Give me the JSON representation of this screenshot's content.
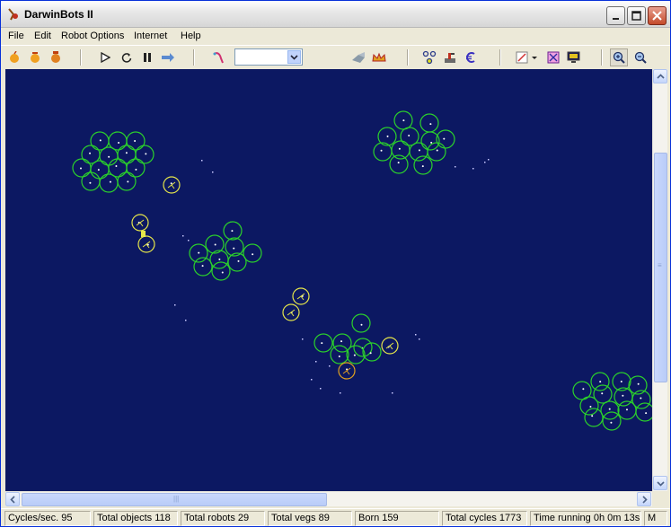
{
  "window": {
    "title": "DarwinBots II"
  },
  "menu": [
    "File",
    "Edit",
    "Robot Options",
    "Internet",
    "Help"
  ],
  "toolbar": {
    "combo_value": "",
    "icons": [
      "new-sim-icon",
      "load-sim-icon",
      "save-sim-icon",
      "play-icon",
      "restart-icon",
      "pause-icon",
      "step-forward-icon",
      "pointer-icon",
      "shape-icon",
      "crown-icon",
      "cells-icon",
      "robot-arm-icon",
      "euro-icon",
      "draw-icon",
      "grid-icon",
      "monitor-icon",
      "zoom-in-icon",
      "zoom-out-icon"
    ]
  },
  "status": {
    "cycles_sec": "Cycles/sec. 95",
    "total_objects": "Total objects 118",
    "total_robots": "Total robots 29",
    "total_vegs": "Total vegs 89",
    "born": "Born 159",
    "total_cycles": "Total cycles 1773",
    "time_running": "Time running 0h 0m 13s",
    "mode": "M"
  },
  "colors": {
    "canvas": "#0c1862",
    "veg": "#2bd12b",
    "robot": "#e6e64a",
    "robot_orange": "#e0a020"
  }
}
